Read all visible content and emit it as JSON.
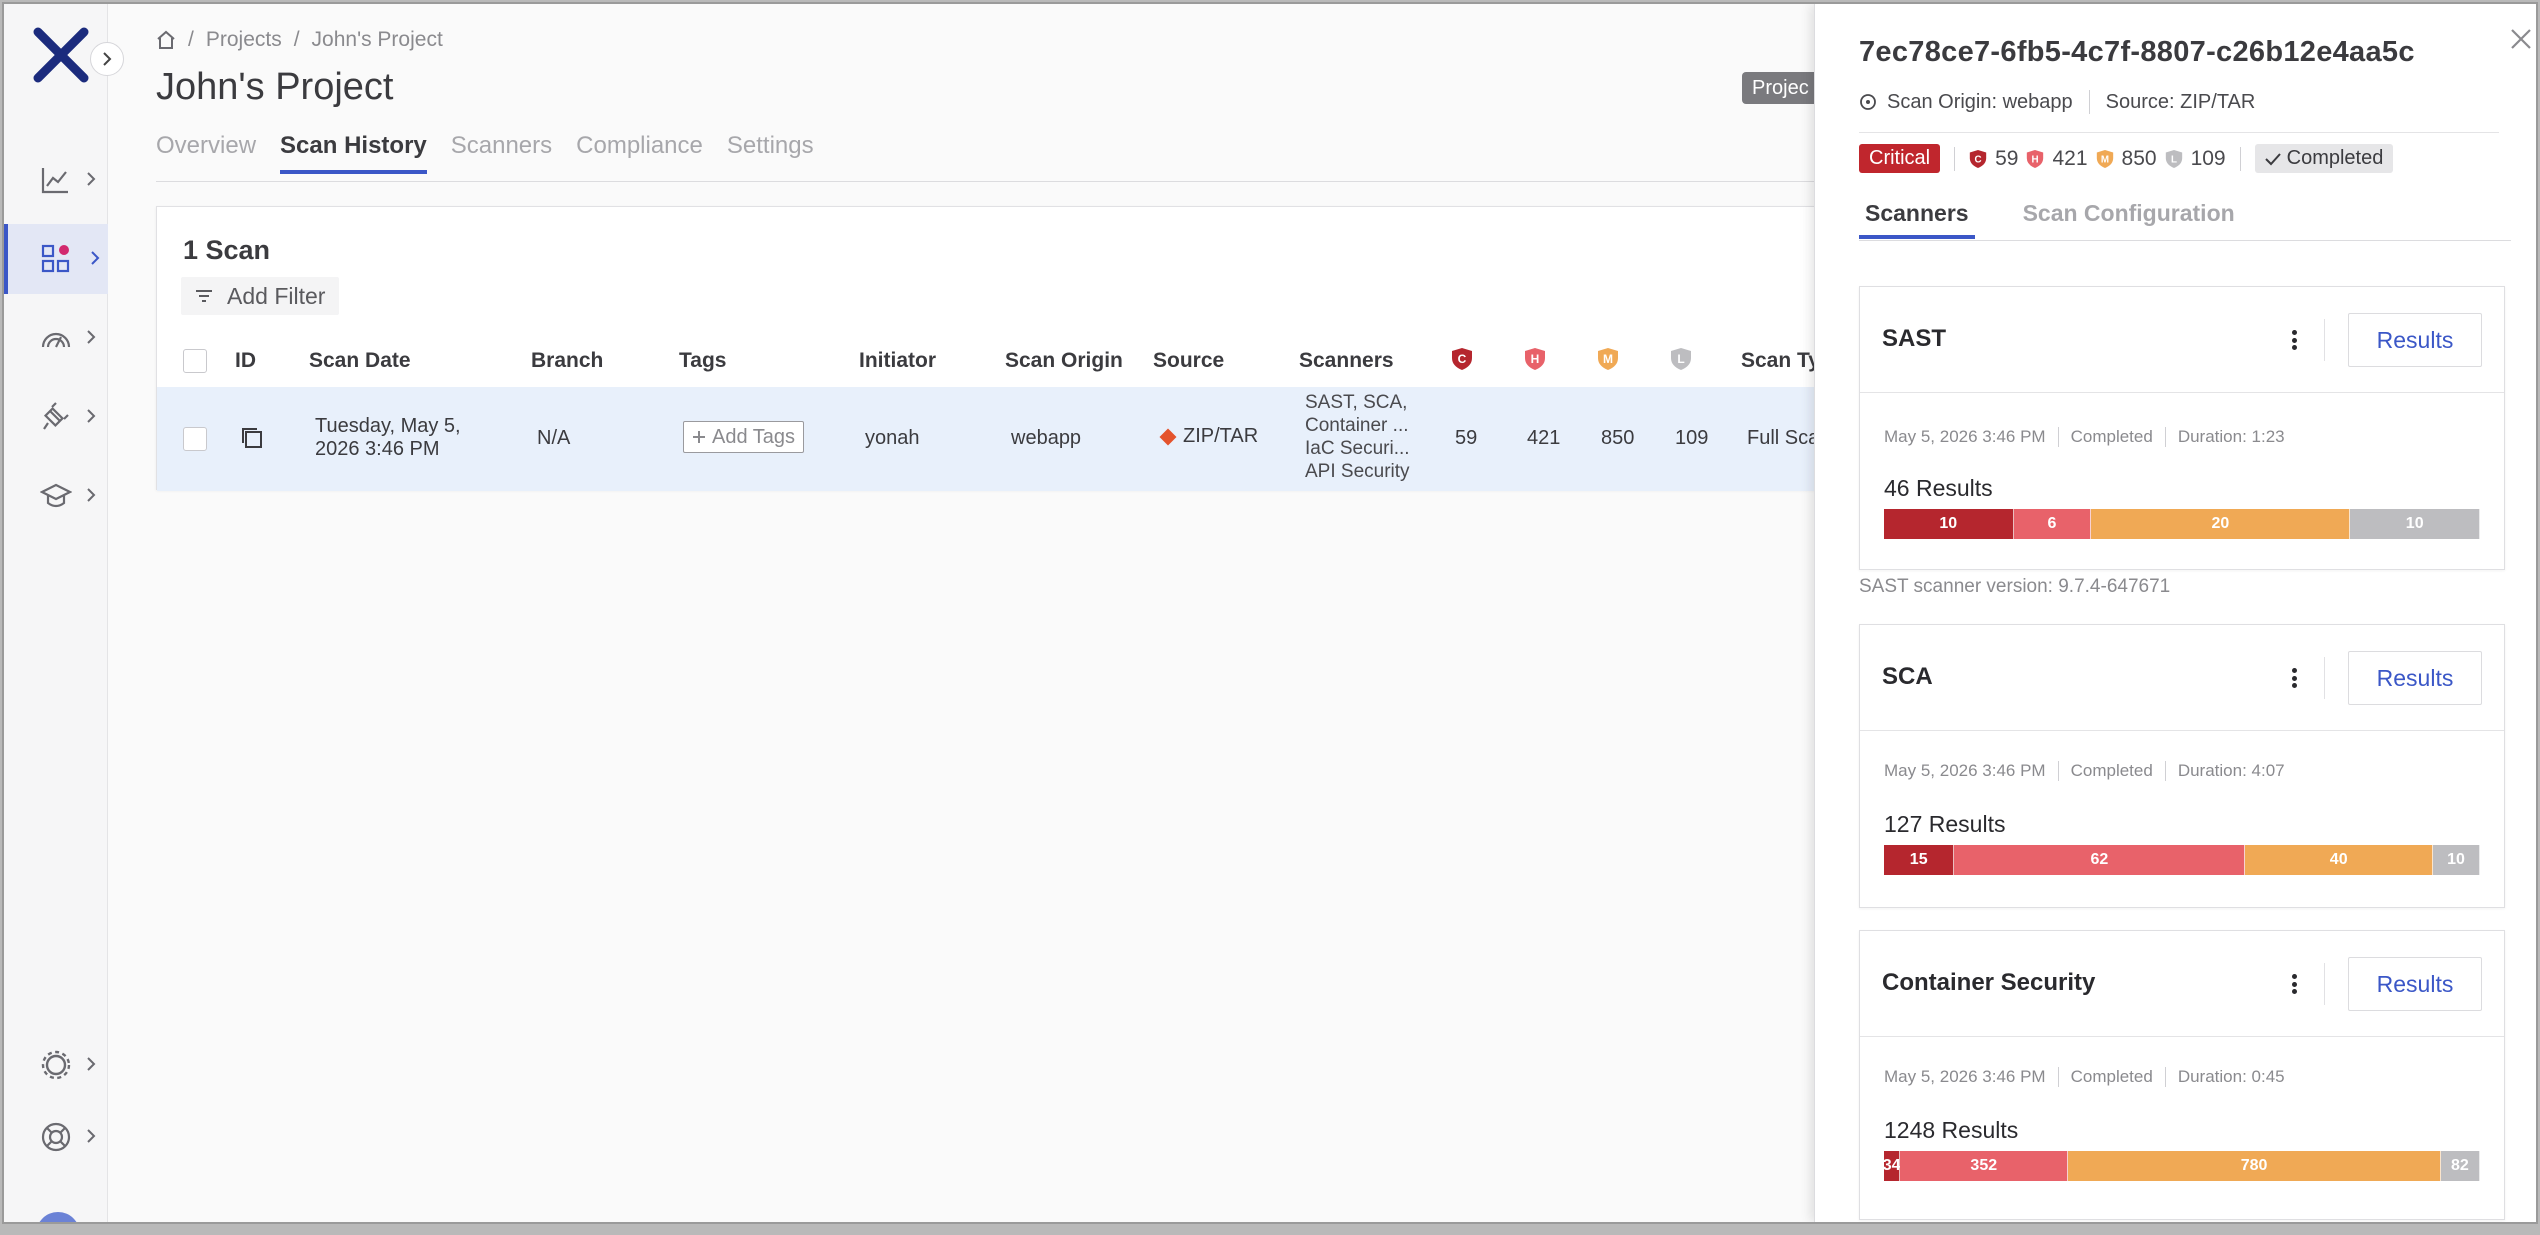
{
  "breadcrumb": {
    "projects": "Projects",
    "project": "John's Project"
  },
  "page": {
    "title": "John's Project",
    "project_badge": "Projec"
  },
  "tabs": [
    "Overview",
    "Scan History",
    "Scanners",
    "Compliance",
    "Settings"
  ],
  "table": {
    "scan_count": "1 Scan",
    "add_filter": "Add Filter",
    "headers": {
      "id": "ID",
      "scan_date": "Scan Date",
      "branch": "Branch",
      "tags": "Tags",
      "initiator": "Initiator",
      "scan_origin": "Scan Origin",
      "source": "Source",
      "scanners": "Scanners",
      "scan_type": "Scan Ty"
    },
    "row": {
      "date_line1": "Tuesday, May 5,",
      "date_line2": "2026 3:46 PM",
      "branch": "N/A",
      "add_tags": "Add Tags",
      "initiator": "yonah",
      "scan_origin": "webapp",
      "source": "ZIP/TAR",
      "scanners": [
        "SAST, SCA,",
        "Container ...",
        "IaC Securi...",
        "API Security"
      ],
      "critical": "59",
      "high": "421",
      "medium": "850",
      "low": "109",
      "scan_type": "Full Sca"
    }
  },
  "severity_letters": {
    "critical": "C",
    "high": "H",
    "medium": "M",
    "low": "L"
  },
  "colors": {
    "critical": "#b5262e",
    "high": "#e8626a",
    "medium": "#f0a955",
    "low": "#bdbdc0",
    "accent": "#3b57c7",
    "logo": "#1b2b7d"
  },
  "panel": {
    "scan_id": "7ec78ce7-6fb5-4c7f-8807-c26b12e4aa5c",
    "scan_origin": "Scan Origin: webapp",
    "source": "Source: ZIP/TAR",
    "risk": "Critical",
    "counts": {
      "critical": "59",
      "high": "421",
      "medium": "850",
      "low": "109"
    },
    "status": "Completed",
    "tabs": [
      "Scanners",
      "Scan Configuration"
    ],
    "results_label": "Results",
    "scanners": [
      {
        "name": "SAST",
        "date": "May 5, 2026 3:46 PM",
        "status": "Completed",
        "duration": "Duration: 1:23",
        "results": "46 Results",
        "bar": [
          10,
          6,
          20,
          10
        ],
        "version": "SAST scanner version: 9.7.4-647671"
      },
      {
        "name": "SCA",
        "date": "May 5, 2026 3:46 PM",
        "status": "Completed",
        "duration": "Duration: 4:07",
        "results": "127 Results",
        "bar": [
          15,
          62,
          40,
          10
        ]
      },
      {
        "name": "Container Security",
        "date": "May 5, 2026 3:46 PM",
        "status": "Completed",
        "duration": "Duration: 0:45",
        "results": "1248 Results",
        "bar": [
          34,
          352,
          780,
          82
        ]
      }
    ]
  }
}
